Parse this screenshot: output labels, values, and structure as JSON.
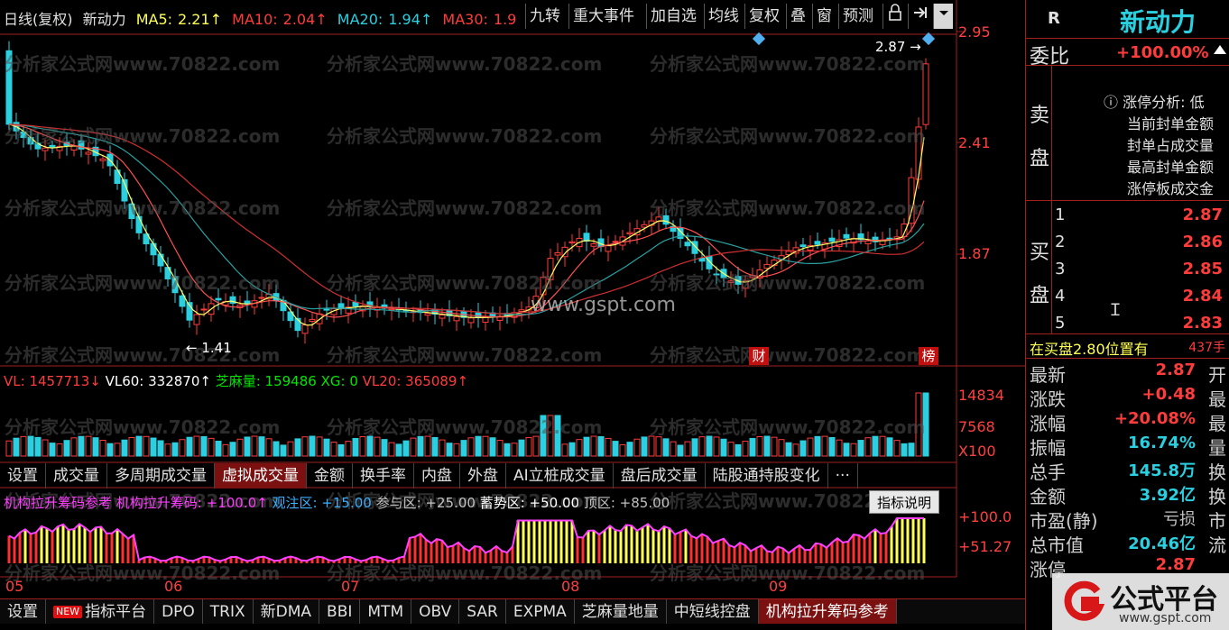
{
  "title_bar": {
    "period": "日线(复权)",
    "stock_name": "新动力",
    "ma5_label": "MA5:",
    "ma5_value": "2.21↑",
    "ma10_label": "MA10:",
    "ma10_value": "2.04↑",
    "ma20_label": "MA20:",
    "ma20_value": "1.94↑",
    "ma30_label": "MA30:",
    "ma30_value": "1.9"
  },
  "toolbar": [
    "九转",
    "重大事件",
    "加自选",
    "均线",
    "复权",
    "叠",
    "窗",
    "预测"
  ],
  "price_axis": [
    "2.95",
    "2.41",
    "1.87"
  ],
  "chart_annotations": {
    "high_label": "2.87",
    "low_label": "1.41",
    "financial_badge": "财",
    "list_badge": "榜",
    "site_text": "www.gspt.com"
  },
  "watermark": "分析家公式网www.70822.com",
  "volume_header": {
    "vl": "VL: 1457713↓",
    "vl60": "VL60: 332870↑",
    "zml": "芝麻量: 159486",
    "xg": "XG: 0",
    "vl20": "VL20: 365089↑"
  },
  "volume_axis": [
    "14834",
    "7568",
    "X100"
  ],
  "indicator_tabs": [
    "设置",
    "成交量",
    "多周期成交量",
    "虚拟成交量",
    "金额",
    "换手率",
    "内盘",
    "外盘",
    "AI立桩成交量",
    "盘后成交量",
    "陆股通持股变化",
    "···"
  ],
  "indicator_tabs_active": "虚拟成交量",
  "indicator_header": {
    "name": "机构拉升筹码参考",
    "value": "机构拉升筹码: +100.0↑",
    "watch": "观注区: +15.00",
    "join": "参与区: +25.00",
    "accum": "蓄势区: +50.00",
    "top": "顶区: +85.00",
    "help_button": "指标说明"
  },
  "indicator_axis": [
    "+100.0",
    "+51.27"
  ],
  "month_labels": [
    "05",
    "06",
    "07",
    "08",
    "09"
  ],
  "bottom_tabs": [
    "设置",
    "指标平台",
    "DPO",
    "TRIX",
    "新DMA",
    "BBI",
    "MTM",
    "OBV",
    "SAR",
    "EXPMA",
    "芝麻量地量",
    "中短线控盘",
    "机构拉升筹码参考"
  ],
  "bottom_tabs_active": "机构拉升筹码参考",
  "bottom_new_badge": "NEW",
  "right_panel": {
    "r_label": "R",
    "name": "新动力",
    "weibi_label": "委比",
    "weibi_value": "+100.00%",
    "sell_label_1": "卖",
    "sell_label_2": "盘",
    "limit_analysis_title": "涨停分析: 低",
    "limit_items": [
      "当前封单金额",
      "封单占成交量",
      "最高封单金额",
      "涨停板成交金"
    ],
    "buy_label_1": "买",
    "buy_label_2": "盘",
    "bids": [
      {
        "level": "1",
        "price": "2.87"
      },
      {
        "level": "2",
        "price": "2.86"
      },
      {
        "level": "3",
        "price": "2.85"
      },
      {
        "level": "4",
        "price": "2.84"
      },
      {
        "level": "5",
        "price": "2.83"
      }
    ],
    "order_note": "在买盘2.80位置有",
    "order_note_qty": "437手",
    "quotes": [
      {
        "label": "最新",
        "value": "2.87",
        "suffix": "开"
      },
      {
        "label": "涨跌",
        "value": "+0.48",
        "suffix": "最"
      },
      {
        "label": "涨幅",
        "value": "+20.08%",
        "suffix": "最"
      },
      {
        "label": "振幅",
        "value": "16.74%",
        "suffix": "量"
      },
      {
        "label": "总手",
        "value": "145.8万",
        "suffix": "换"
      },
      {
        "label": "金额",
        "value": "3.92亿",
        "suffix": "换"
      },
      {
        "label": "市盈(静)",
        "value": "亏损",
        "suffix": "市"
      },
      {
        "label": "总市值",
        "value": "20.46亿",
        "suffix": "流"
      },
      {
        "label": "涨停",
        "value": "2.87",
        "suffix": ""
      }
    ]
  },
  "logo": {
    "main": "公式平台",
    "sub": "www.gspt.com"
  },
  "colors": {
    "up": "#ff3c3c",
    "down": "#2ad0e0",
    "ma5": "#ffff66",
    "ma10": "#ff5050",
    "ma20": "#2aa0a0",
    "ma30": "#d03030",
    "frame": "#a02020"
  }
}
